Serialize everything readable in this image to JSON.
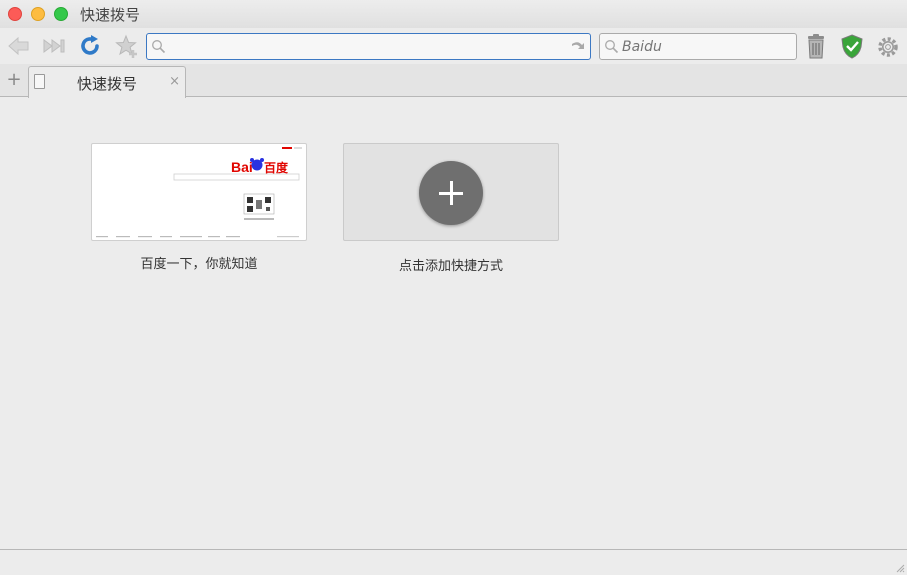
{
  "window": {
    "title": "快速拨号"
  },
  "toolbar": {
    "address_value": "",
    "search_engine_value": "Baidu"
  },
  "tabs": [
    {
      "title": "快速拨号",
      "close": "×"
    }
  ],
  "new_tab_symbol": "+",
  "speed_dial": [
    {
      "label": "百度一下，你就知道",
      "thumbnail": {
        "logo_text": "Bai",
        "logo_text_2": "百度"
      }
    },
    {
      "label": "点击添加快捷方式"
    }
  ],
  "colors": {
    "accent_blue": "#3c78c3",
    "baidu_red": "#e10601",
    "baidu_blue": "#2932e1",
    "shield_green": "#3aa53a"
  },
  "icons": {
    "back": "back-arrow-icon",
    "fast_forward": "fast-forward-icon",
    "reload": "reload-icon",
    "bookmark": "star-add-icon",
    "trash": "trash-icon",
    "shield": "shield-check-icon",
    "settings": "gear-icon"
  }
}
